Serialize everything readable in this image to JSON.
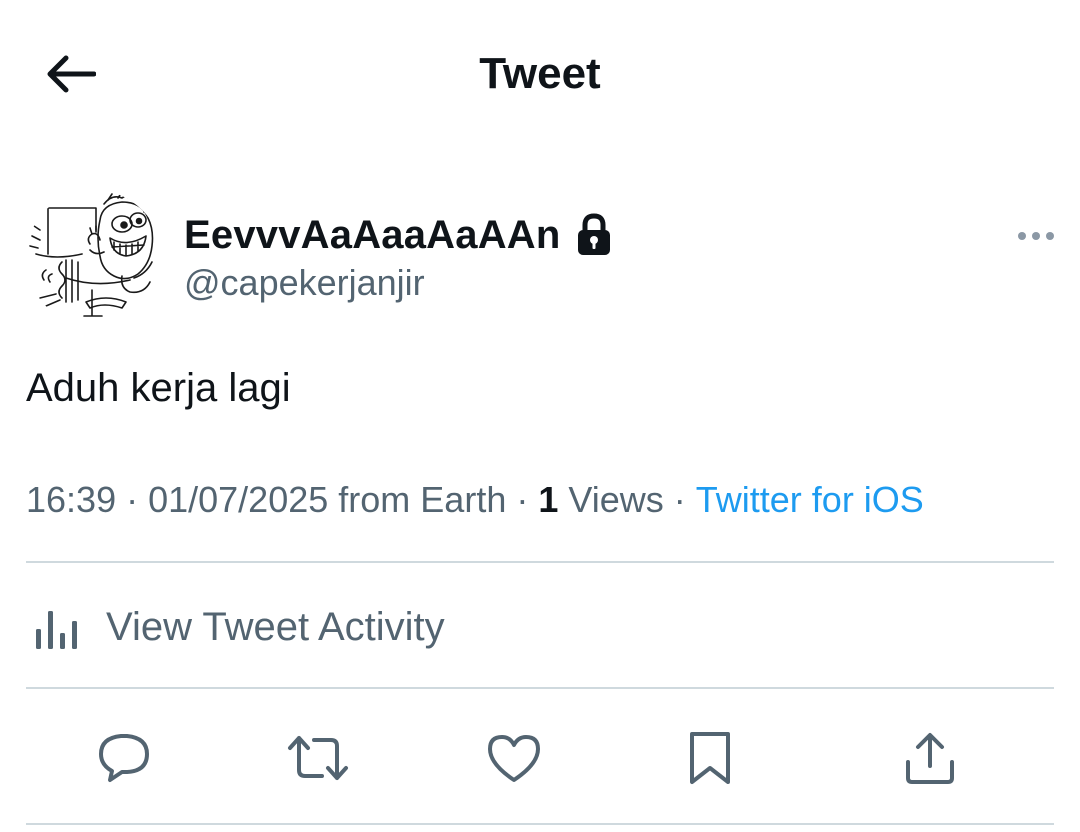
{
  "header": {
    "title": "Tweet",
    "back_icon": "arrow-left-icon"
  },
  "author": {
    "display_name": "EevvvAaAaaAaAAn",
    "handle": "@capekerjanjir",
    "protected_icon": "lock-icon",
    "avatar": "cartoon-sketch-avatar"
  },
  "tweet": {
    "text": "Aduh kerja lagi"
  },
  "meta": {
    "time": "16:39",
    "date": "01/07/2025",
    "location": "from Earth",
    "separator": "·",
    "views_count": "1",
    "views_label": "Views",
    "source": "Twitter for iOS"
  },
  "activity": {
    "label": "View Tweet Activity",
    "icon": "analytics-bar-chart-icon"
  },
  "actions": [
    {
      "name": "reply",
      "icon": "reply-bubble-icon"
    },
    {
      "name": "retweet",
      "icon": "retweet-icon"
    },
    {
      "name": "like",
      "icon": "heart-icon"
    },
    {
      "name": "bookmark",
      "icon": "bookmark-icon"
    },
    {
      "name": "share",
      "icon": "share-icon"
    }
  ],
  "colors": {
    "text_primary": "#0f1419",
    "text_secondary": "#536471",
    "link": "#1d9bf0",
    "divider": "#cfd9de",
    "background": "#ffffff"
  }
}
